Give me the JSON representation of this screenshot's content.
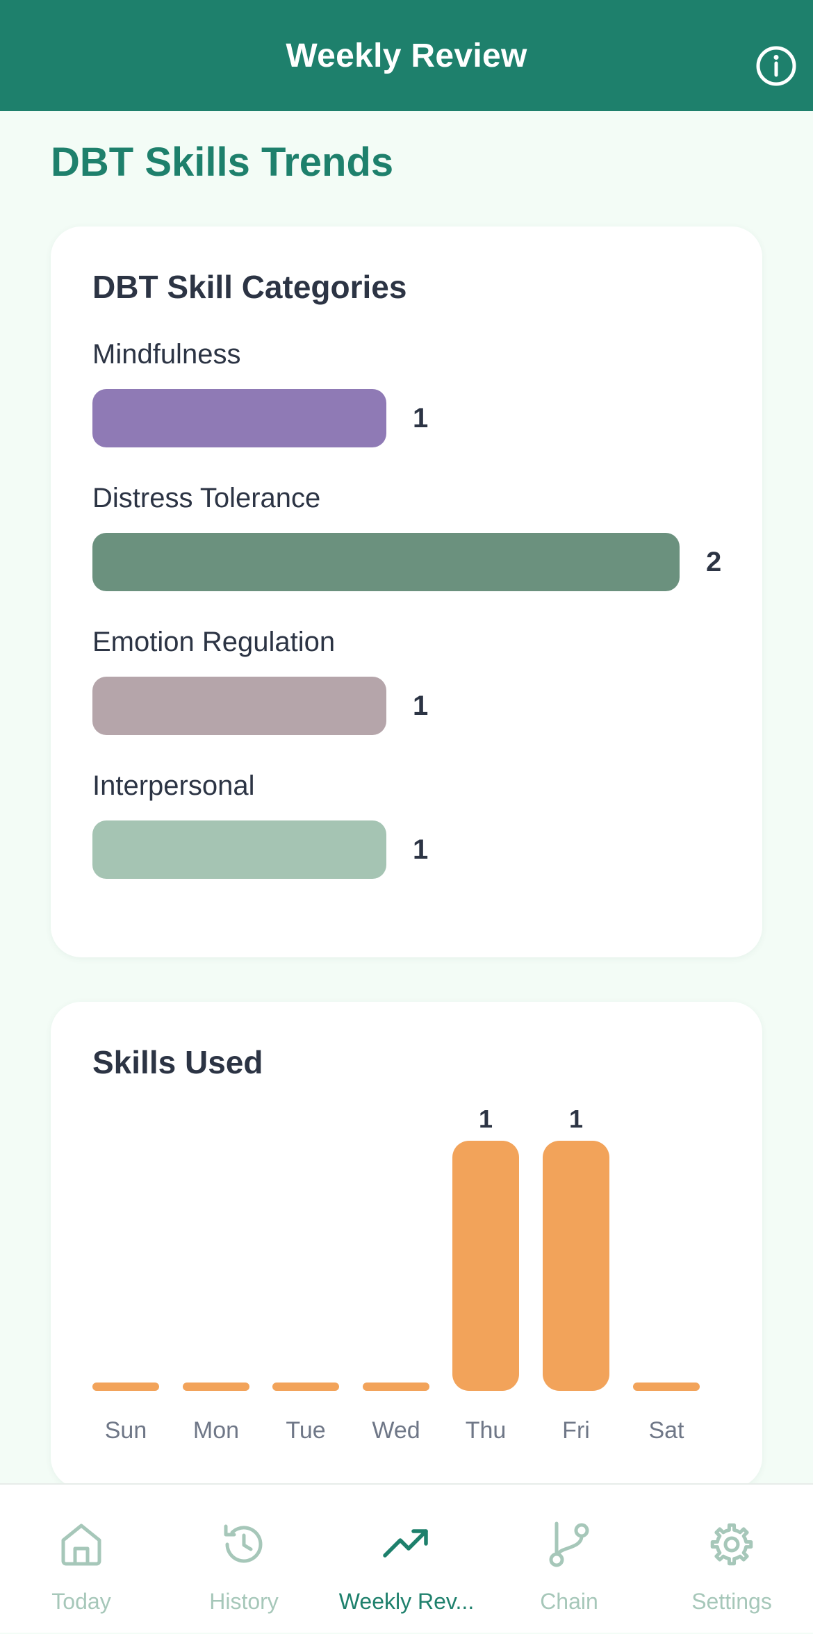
{
  "header": {
    "title": "Weekly Review",
    "info_icon": "info-circle-icon"
  },
  "page": {
    "title": "DBT Skills Trends"
  },
  "categories_card": {
    "title": "DBT Skill Categories",
    "max_value": 2,
    "items": [
      {
        "label": "Mindfulness",
        "value": 1,
        "color": "#8f7ab5"
      },
      {
        "label": "Distress Tolerance",
        "value": 2,
        "color": "#6b917e"
      },
      {
        "label": "Emotion Regulation",
        "value": 1,
        "color": "#b5a5aa"
      },
      {
        "label": "Interpersonal",
        "value": 1,
        "color": "#a5c4b3"
      }
    ]
  },
  "skills_card": {
    "title": "Skills Used",
    "bar_color": "#f2a35a",
    "chart_data": {
      "type": "bar",
      "categories": [
        "Sun",
        "Mon",
        "Tue",
        "Wed",
        "Thu",
        "Fri",
        "Sat"
      ],
      "values": [
        0,
        0,
        0,
        0,
        1,
        1,
        0
      ],
      "data_labels": [
        "",
        "",
        "",
        "",
        "1",
        "1",
        ""
      ],
      "ylim": [
        0,
        1
      ],
      "grid": false
    }
  },
  "tabbar": {
    "active_index": 2,
    "tabs": [
      {
        "label": "Today",
        "icon": "home-icon"
      },
      {
        "label": "History",
        "icon": "history-icon"
      },
      {
        "label": "Weekly Rev...",
        "icon": "trending-up-icon"
      },
      {
        "label": "Chain",
        "icon": "git-branch-icon"
      },
      {
        "label": "Settings",
        "icon": "gear-icon"
      }
    ]
  },
  "colors": {
    "header_bg": "#1e806c",
    "accent": "#1e806c",
    "inactive_tab": "#a6c7b9",
    "page_bg": "#f3fcf6"
  }
}
